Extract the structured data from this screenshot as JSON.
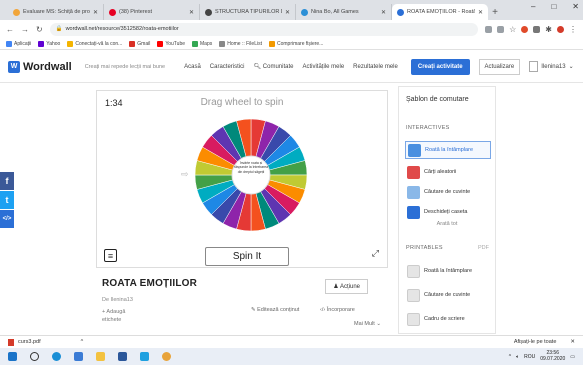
{
  "browser": {
    "tabs": [
      {
        "label": "Evaluare MS: Schiță de proiect",
        "color": "#f1a53a"
      },
      {
        "label": "(38) Pinterest",
        "color": "#e60023"
      },
      {
        "label": "STRUCTURA TIPURILOR DE LI...",
        "color": "#444444"
      },
      {
        "label": "Nina Bo, All Games",
        "color": "#2b8fd6"
      },
      {
        "label": "ROATA EMOȚIILOR - Roată la",
        "color": "#2b6fd6"
      }
    ],
    "new_tab": "+",
    "window_controls": [
      "–",
      "□",
      "✕"
    ],
    "url": "wordwall.net/resource/3512582/roata-emotiilor",
    "bookmarks": [
      {
        "label": "Aplicații",
        "color": "#4285f4"
      },
      {
        "label": "Yahoo",
        "color": "#6001d2"
      },
      {
        "label": "Conectați-vă la con...",
        "color": "#f4b400"
      },
      {
        "label": "Gmail",
        "color": "#d93025"
      },
      {
        "label": "YouTube",
        "color": "#ff0000"
      },
      {
        "label": "Maps",
        "color": "#34a853"
      },
      {
        "label": "Home :: FileList",
        "color": "#888888"
      },
      {
        "label": "Comprimare fișiere...",
        "color": "#f29900"
      }
    ]
  },
  "header": {
    "logo": "Wordwall",
    "tagline": "Creați mai repede lecții mai bune",
    "nav": [
      "Acasă",
      "Caracteristici",
      "Comunitate",
      "Activitățile mele",
      "Rezultatele mele"
    ],
    "create_button": "Creați activitate",
    "update_button": "Actualizare",
    "username": "Ilenina13"
  },
  "activity": {
    "timer": "1:34",
    "hint": "Drag wheel to spin",
    "spin_label": "Spin It",
    "wheel_center": "Învârte roata și răspunde la întrebarea din dreptul săgeții"
  },
  "info": {
    "title": "ROATA EMOȚIILOR",
    "author_prefix": "De",
    "author": "Ilenina13",
    "add_tags": "+ Adaugă etichete",
    "actions_button": "Acțiune",
    "edit": "Editează conținut",
    "embed": "Încorporare",
    "more": "Mai Mult"
  },
  "panel": {
    "title": "Șablon de comutare",
    "interactives_label": "INTERACTIVES",
    "interactives": [
      {
        "label": "Roată la întâmplare",
        "color": "#4a8fe0"
      },
      {
        "label": "Cărți aleatorii",
        "color": "#e04a4a"
      },
      {
        "label": "Căutare de cuvinte",
        "color": "#8ab8e8"
      },
      {
        "label": "Deschideți caseta",
        "color": "#2b6fd6"
      }
    ],
    "show_all": "Arată tot",
    "printables_label": "PRINTABLES",
    "pdf_label": "PDF",
    "printables": [
      {
        "label": "Roată la întâmplare",
        "color": "#cccccc"
      },
      {
        "label": "Căutare de cuvinte",
        "color": "#cccccc"
      },
      {
        "label": "Cadru de scriere",
        "color": "#cccccc"
      }
    ]
  },
  "social": [
    {
      "label": "f",
      "color": "#3b5998"
    },
    {
      "label": "t",
      "color": "#1da1f2"
    },
    {
      "label": "</>",
      "color": "#2b6fd6"
    }
  ],
  "download": {
    "file": "curs3.pdf",
    "show_all": "Afișați-le pe toate"
  },
  "taskbar": {
    "lang": "ROU",
    "time": "23:56",
    "date": "09.07.2020"
  }
}
